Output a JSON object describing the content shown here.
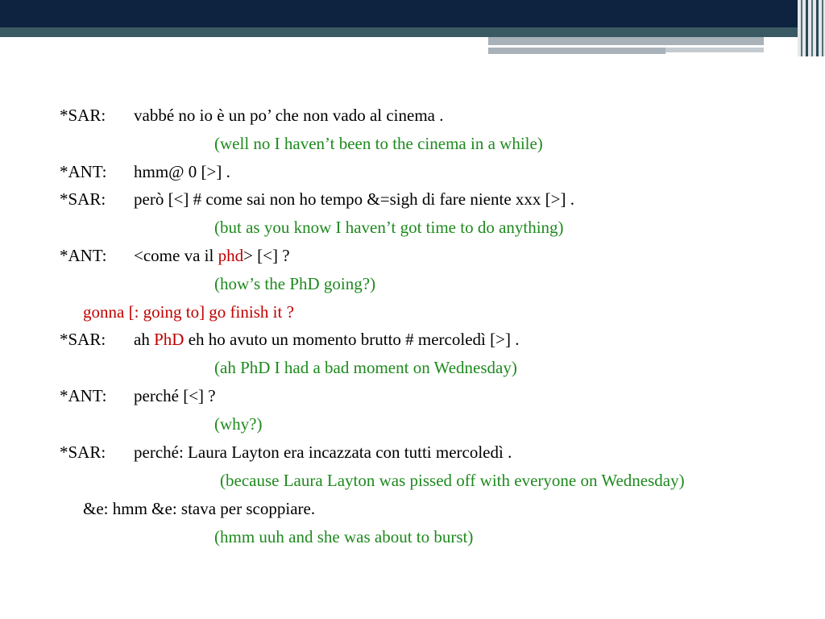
{
  "colors": {
    "header_dark": "#0e2340",
    "header_teal": "#3a5a63",
    "translation_green": "#1e8a1e",
    "highlight_red": "#c00000"
  },
  "lines": [
    {
      "speaker": "*SAR:",
      "text": "vabbé no io è un po’ che non vado al cinema ."
    },
    {
      "translation": "(well no I haven’t been to the cinema in a while)"
    },
    {
      "speaker": "*ANT:",
      "text": "hmm@ 0 [>] ."
    },
    {
      "speaker": "*SAR:",
      "text": "però [<] # come sai non ho tempo &=sigh di fare niente xxx  [>] ."
    },
    {
      "translation": "(but as you know I haven’t got time to do anything)"
    },
    {
      "speaker": "*ANT:",
      "pre": "<come va il ",
      "highlight": "phd",
      "post": "> [<] ?"
    },
    {
      "translation": "(how’s the PhD going?)"
    },
    {
      "continuation_red": "gonna [: going to] go finish it ?"
    },
    {
      "speaker": "*SAR:",
      "pre": "ah ",
      "highlight": "PhD",
      "post": " eh ho avuto un momento brutto # mercoledì [>] ."
    },
    {
      "translation": "(ah PhD I had a  bad moment on Wednesday)"
    },
    {
      "speaker": "*ANT:",
      "text": "perché [<] ?"
    },
    {
      "translation": "(why?)"
    },
    {
      "speaker": "*SAR:",
      "text": "perché: Laura Layton era incazzata con tutti mercoledì ."
    },
    {
      "translation_wrapped": "(because Laura Layton was pissed off with everyone on Wednesday)"
    },
    {
      "continuation": "&e: hmm &e: stava per scoppiare."
    },
    {
      "translation": "(hmm uuh and she was about to burst)"
    }
  ]
}
